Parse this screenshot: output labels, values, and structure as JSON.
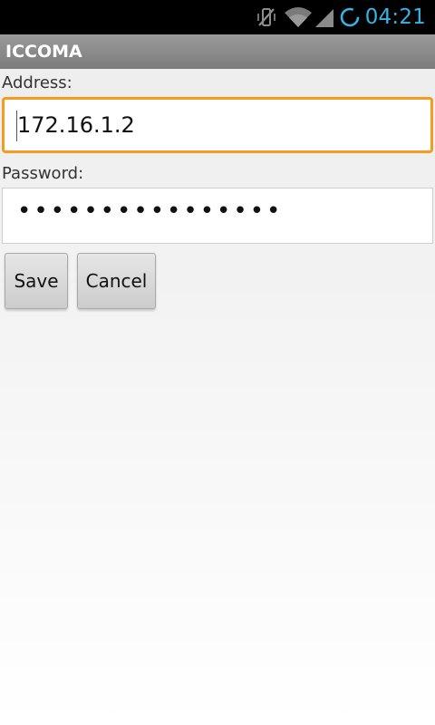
{
  "status_bar": {
    "time": "04:21",
    "icons": [
      "vibrate-off-icon",
      "wifi-icon",
      "signal-icon",
      "sync-circle-icon"
    ]
  },
  "app": {
    "title": "ICCOMA"
  },
  "form": {
    "address_label": "Address:",
    "address_value": "172.16.1.2",
    "password_label": "Password:",
    "password_masked": "••••••••••••••••"
  },
  "buttons": {
    "save": "Save",
    "cancel": "Cancel"
  },
  "colors": {
    "accent": "#33b5e5",
    "focus_border": "#f79a1e",
    "title_bar": "#8a8a8a"
  }
}
